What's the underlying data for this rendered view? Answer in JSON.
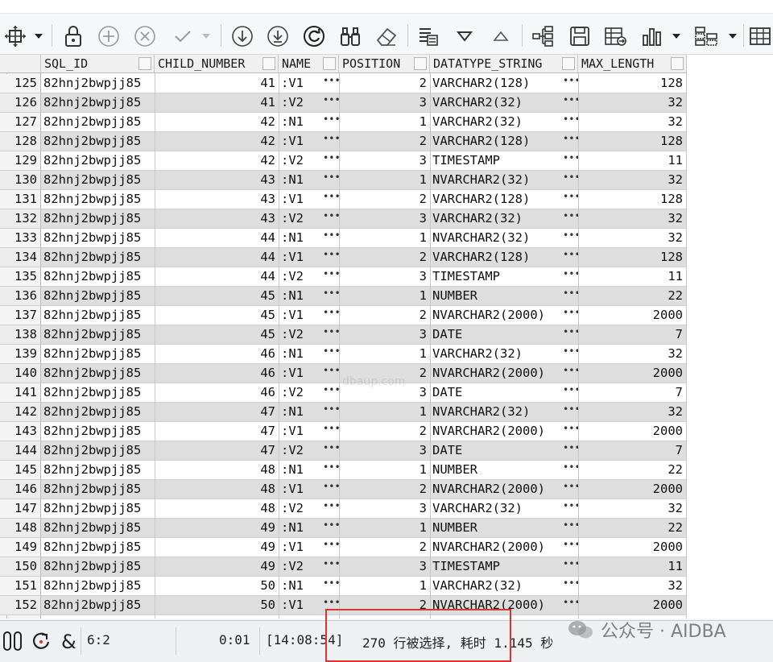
{
  "columns": [
    "SQL_ID",
    "CHILD_NUMBER",
    "NAME",
    "POSITION",
    "DATATYPE_STRING",
    "MAX_LENGTH"
  ],
  "rows": [
    {
      "n": "125",
      "sql": "82hnj2bwpjj85",
      "child": "41",
      "name": ":V1",
      "pos": "2",
      "dt": "VARCHAR2(128)",
      "max": "128"
    },
    {
      "n": "126",
      "sql": "82hnj2bwpjj85",
      "child": "41",
      "name": ":V2",
      "pos": "3",
      "dt": "VARCHAR2(32)",
      "max": "32"
    },
    {
      "n": "127",
      "sql": "82hnj2bwpjj85",
      "child": "42",
      "name": ":N1",
      "pos": "1",
      "dt": "VARCHAR2(32)",
      "max": "32"
    },
    {
      "n": "128",
      "sql": "82hnj2bwpjj85",
      "child": "42",
      "name": ":V1",
      "pos": "2",
      "dt": "VARCHAR2(128)",
      "max": "128"
    },
    {
      "n": "129",
      "sql": "82hnj2bwpjj85",
      "child": "42",
      "name": ":V2",
      "pos": "3",
      "dt": "TIMESTAMP",
      "max": "11"
    },
    {
      "n": "130",
      "sql": "82hnj2bwpjj85",
      "child": "43",
      "name": ":N1",
      "pos": "1",
      "dt": "NVARCHAR2(32)",
      "max": "32"
    },
    {
      "n": "131",
      "sql": "82hnj2bwpjj85",
      "child": "43",
      "name": ":V1",
      "pos": "2",
      "dt": "VARCHAR2(128)",
      "max": "128"
    },
    {
      "n": "132",
      "sql": "82hnj2bwpjj85",
      "child": "43",
      "name": ":V2",
      "pos": "3",
      "dt": "VARCHAR2(32)",
      "max": "32"
    },
    {
      "n": "133",
      "sql": "82hnj2bwpjj85",
      "child": "44",
      "name": ":N1",
      "pos": "1",
      "dt": "NVARCHAR2(32)",
      "max": "32"
    },
    {
      "n": "134",
      "sql": "82hnj2bwpjj85",
      "child": "44",
      "name": ":V1",
      "pos": "2",
      "dt": "VARCHAR2(128)",
      "max": "128"
    },
    {
      "n": "135",
      "sql": "82hnj2bwpjj85",
      "child": "44",
      "name": ":V2",
      "pos": "3",
      "dt": "TIMESTAMP",
      "max": "11"
    },
    {
      "n": "136",
      "sql": "82hnj2bwpjj85",
      "child": "45",
      "name": ":N1",
      "pos": "1",
      "dt": "NUMBER",
      "max": "22"
    },
    {
      "n": "137",
      "sql": "82hnj2bwpjj85",
      "child": "45",
      "name": ":V1",
      "pos": "2",
      "dt": "NVARCHAR2(2000)",
      "max": "2000"
    },
    {
      "n": "138",
      "sql": "82hnj2bwpjj85",
      "child": "45",
      "name": ":V2",
      "pos": "3",
      "dt": "DATE",
      "max": "7"
    },
    {
      "n": "139",
      "sql": "82hnj2bwpjj85",
      "child": "46",
      "name": ":N1",
      "pos": "1",
      "dt": "VARCHAR2(32)",
      "max": "32"
    },
    {
      "n": "140",
      "sql": "82hnj2bwpjj85",
      "child": "46",
      "name": ":V1",
      "pos": "2",
      "dt": "NVARCHAR2(2000)",
      "max": "2000"
    },
    {
      "n": "141",
      "sql": "82hnj2bwpjj85",
      "child": "46",
      "name": ":V2",
      "pos": "3",
      "dt": "DATE",
      "max": "7"
    },
    {
      "n": "142",
      "sql": "82hnj2bwpjj85",
      "child": "47",
      "name": ":N1",
      "pos": "1",
      "dt": "NVARCHAR2(32)",
      "max": "32"
    },
    {
      "n": "143",
      "sql": "82hnj2bwpjj85",
      "child": "47",
      "name": ":V1",
      "pos": "2",
      "dt": "NVARCHAR2(2000)",
      "max": "2000"
    },
    {
      "n": "144",
      "sql": "82hnj2bwpjj85",
      "child": "47",
      "name": ":V2",
      "pos": "3",
      "dt": "DATE",
      "max": "7"
    },
    {
      "n": "145",
      "sql": "82hnj2bwpjj85",
      "child": "48",
      "name": ":N1",
      "pos": "1",
      "dt": "NUMBER",
      "max": "22"
    },
    {
      "n": "146",
      "sql": "82hnj2bwpjj85",
      "child": "48",
      "name": ":V1",
      "pos": "2",
      "dt": "NVARCHAR2(2000)",
      "max": "2000"
    },
    {
      "n": "147",
      "sql": "82hnj2bwpjj85",
      "child": "48",
      "name": ":V2",
      "pos": "3",
      "dt": "VARCHAR2(32)",
      "max": "32"
    },
    {
      "n": "148",
      "sql": "82hnj2bwpjj85",
      "child": "49",
      "name": ":N1",
      "pos": "1",
      "dt": "NUMBER",
      "max": "22"
    },
    {
      "n": "149",
      "sql": "82hnj2bwpjj85",
      "child": "49",
      "name": ":V1",
      "pos": "2",
      "dt": "NVARCHAR2(2000)",
      "max": "2000"
    },
    {
      "n": "150",
      "sql": "82hnj2bwpjj85",
      "child": "49",
      "name": ":V2",
      "pos": "3",
      "dt": "TIMESTAMP",
      "max": "11"
    },
    {
      "n": "151",
      "sql": "82hnj2bwpjj85",
      "child": "50",
      "name": ":N1",
      "pos": "1",
      "dt": "VARCHAR2(32)",
      "max": "32"
    },
    {
      "n": "152",
      "sql": "82hnj2bwpjj85",
      "child": "50",
      "name": ":V1",
      "pos": "2",
      "dt": "NVARCHAR2(2000)",
      "max": "2000"
    }
  ],
  "cell_ellipsis": "•••",
  "status": {
    "cursor": "6:2",
    "elapsed": "0:01",
    "time": "[14:08:54]",
    "message": "270 行被选择, 耗时 1.145 秒"
  },
  "watermark": "公众号 · AIDBA",
  "toolbar_icons": [
    "move-icon",
    "lock-icon",
    "add-icon",
    "cancel-icon",
    "check-icon",
    "scroll-down-icon",
    "download-icon",
    "refresh-icon",
    "binoculars-icon",
    "eraser-icon",
    "export-icon",
    "filter-down-icon",
    "filter-up-icon",
    "tree-icon",
    "save-icon",
    "table-export-icon",
    "bar-chart-icon",
    "layout-icon",
    "grid-icon"
  ]
}
